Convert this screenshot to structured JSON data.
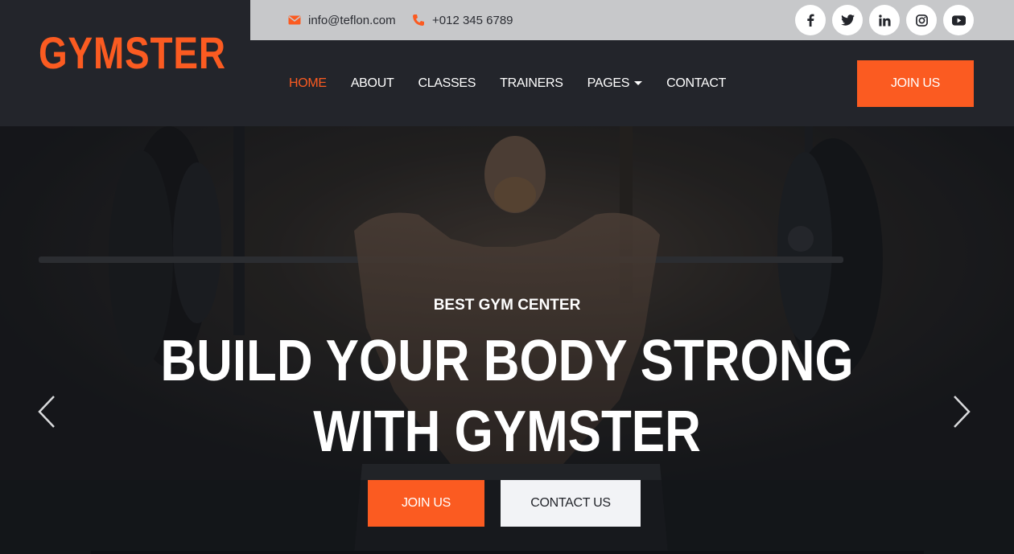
{
  "brand": {
    "name": "GYMSTER",
    "color": "#fb5b21"
  },
  "topbar": {
    "email": "info@teflon.com",
    "phone": "+012 345 6789",
    "socials": [
      {
        "name": "facebook",
        "glyph": "f"
      },
      {
        "name": "twitter",
        "glyph": "twitter-bird"
      },
      {
        "name": "linkedin",
        "glyph": "in"
      },
      {
        "name": "instagram",
        "glyph": "camera"
      },
      {
        "name": "youtube",
        "glyph": "play"
      }
    ]
  },
  "nav": {
    "items": [
      {
        "label": "HOME",
        "active": true
      },
      {
        "label": "ABOUT"
      },
      {
        "label": "CLASSES"
      },
      {
        "label": "TRAINERS"
      },
      {
        "label": "PAGES",
        "dropdown": true
      },
      {
        "label": "CONTACT"
      }
    ],
    "cta": "JOIN US"
  },
  "hero": {
    "subtitle": "BEST GYM CENTER",
    "title_line1": "BUILD YOUR BODY STRONG",
    "title_line2": "WITH GYMSTER",
    "primary_button": "JOIN US",
    "secondary_button": "CONTACT US"
  },
  "colors": {
    "accent": "#fb5b21",
    "dark": "#23252b",
    "topbar": "#c7c8ca",
    "light_button": "#f2f3f6"
  }
}
